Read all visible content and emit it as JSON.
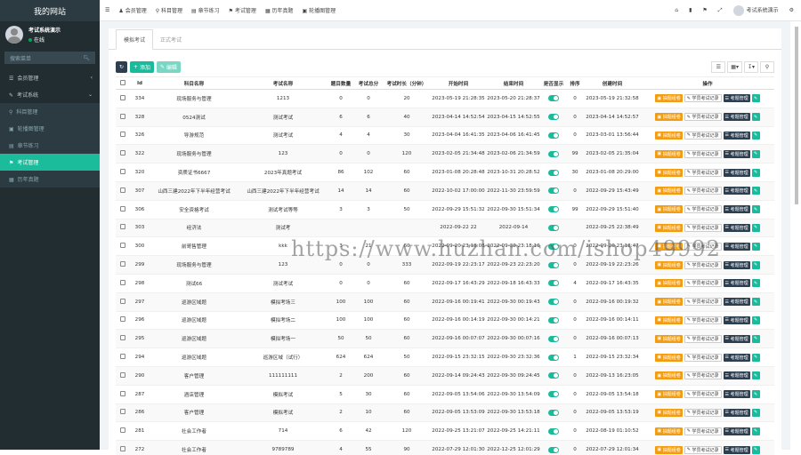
{
  "sidebar": {
    "site_title": "我的网站",
    "user_name": "考试系统演示",
    "user_status": "在线",
    "search_placeholder": "搜索菜单",
    "items": [
      {
        "label": "会员管理",
        "icon": "list-icon"
      },
      {
        "label": "考试系统",
        "icon": "pencil-icon"
      },
      {
        "label": "科目管理",
        "icon": "pin-icon"
      },
      {
        "label": "轮播图管理",
        "icon": "image-icon"
      },
      {
        "label": "章节练习",
        "icon": "book-icon"
      },
      {
        "label": "考试管理",
        "icon": "flag-icon"
      },
      {
        "label": "历年真题",
        "icon": "calendar-icon"
      }
    ]
  },
  "topbar": {
    "nav": [
      "会员管理",
      "科目管理",
      "章节练习",
      "考试管理",
      "历年真题",
      "轮播图管理"
    ],
    "user_name": "考试系统演示"
  },
  "tabs": [
    "模拟考试",
    "正式考试"
  ],
  "toolbar": {
    "add_label": "添加",
    "edit_label": "编辑"
  },
  "table": {
    "headers": [
      "Id",
      "科目名称",
      "考试名称",
      "题目数量",
      "考试总分",
      "考试时长（分钟）",
      "开始时间",
      "结束时间",
      "是否显示",
      "排序",
      "创建时间",
      "操作"
    ],
    "actions": [
      "抽题组卷",
      "学员考试记录",
      "考题管理"
    ],
    "rows": [
      [
        "334",
        "现场服务与管理",
        "1213",
        "0",
        "0",
        "20",
        "2023-05-19 21:28:35",
        "2023-05-20 21:28:37",
        "0",
        "2023-05-19 21:32:58"
      ],
      [
        "328",
        "0524测试",
        "测试考试",
        "6",
        "6",
        "40",
        "2023-04-14 14:52:54",
        "2023-04-15 14:52:55",
        "0",
        "2023-04-14 14:52:57"
      ],
      [
        "326",
        "导游规范",
        "测试考试",
        "4",
        "4",
        "30",
        "2023-04-04 16:41:35",
        "2023-04-06 16:41:45",
        "0",
        "2023-03-01 13:56:44"
      ],
      [
        "322",
        "现场服务与管理",
        "123",
        "0",
        "0",
        "120",
        "2023-02-05 21:34:48",
        "2023-02-06 21:34:59",
        "99",
        "2023-02-05 21:35:04"
      ],
      [
        "320",
        "资质证书6667",
        "2023年真题考试",
        "86",
        "102",
        "60",
        "2023-01-08 20:28:48",
        "2023-10-31 20:28:52",
        "30",
        "2023-01-08 20:29:00"
      ],
      [
        "307",
        "山西三建2022年下半年经营考试",
        "山西三建2022年下半年经营考试",
        "14",
        "14",
        "60",
        "2022-10-02 17:00:00",
        "2022-11-30 23:59:59",
        "0",
        "2022-09-29 15:43:49"
      ],
      [
        "306",
        "安全资格考试",
        "测试考试等等",
        "3",
        "3",
        "50",
        "2022-09-29 15:51:32",
        "2022-09-30 15:51:34",
        "99",
        "2022-09-29 15:51:40"
      ],
      [
        "303",
        "经济法",
        "测试考",
        "",
        "",
        "",
        "2022-09-22 22",
        "2022-09-14",
        "",
        "2022-09-25 22:38:49"
      ],
      [
        "300",
        "前哥售管理",
        "kkk",
        "3",
        "21",
        "60",
        "2022-09-20 23:18:08",
        "2022-09-30 23:18:10",
        "0",
        "2022-09-20 23:18:47"
      ],
      [
        "299",
        "现场服务与管理",
        "123",
        "0",
        "0",
        "333",
        "2022-09-19 22:23:17",
        "2022-09-23 22:23:20",
        "0",
        "2022-09-19 22:23:26"
      ],
      [
        "298",
        "测试66",
        "测试考试",
        "0",
        "0",
        "60",
        "2022-09-17 16:43:29",
        "2022-09-18 16:43:33",
        "4",
        "2022-09-17 16:43:35"
      ],
      [
        "297",
        "巡游区域题",
        "模拟考场三",
        "100",
        "100",
        "60",
        "2022-09-16 00:19:41",
        "2022-09-30 00:19:43",
        "0",
        "2022-09-16 00:19:32"
      ],
      [
        "296",
        "巡游区域题",
        "模拟考场二",
        "100",
        "100",
        "60",
        "2022-09-16 00:14:19",
        "2022-09-30 00:14:21",
        "0",
        "2022-09-16 00:14:11"
      ],
      [
        "295",
        "巡游区域题",
        "模拟考场一",
        "50",
        "50",
        "60",
        "2022-09-16 00:07:07",
        "2022-09-30 00:07:16",
        "0",
        "2022-09-16 00:07:13"
      ],
      [
        "294",
        "巡游区域题",
        "巡游区域（试行）",
        "624",
        "624",
        "50",
        "2022-09-15 23:32:15",
        "2022-09-30 23:32:36",
        "1",
        "2022-09-15 23:32:34"
      ],
      [
        "290",
        "客户管理",
        "111111111",
        "2",
        "200",
        "60",
        "2022-09-14 09:24:43",
        "2022-09-30 09:24:45",
        "0",
        "2022-09-13 16:23:05"
      ],
      [
        "287",
        "酒店管理",
        "模拟考试",
        "5",
        "30",
        "60",
        "2022-09-05 13:54:06",
        "2022-09-30 13:54:09",
        "0",
        "2022-09-05 13:54:18"
      ],
      [
        "286",
        "客户管理",
        "模拟考试",
        "2",
        "10",
        "60",
        "2022-09-05 13:53:09",
        "2022-09-30 13:53:18",
        "0",
        "2022-09-05 13:53:19"
      ],
      [
        "281",
        "社会工作者",
        "714",
        "6",
        "42",
        "120",
        "2022-09-25 13:21:07",
        "2022-09-25 14:21:11",
        "0",
        "2022-08-19 01:10:52"
      ],
      [
        "272",
        "社会工作者",
        "9789789",
        "4",
        "55",
        "90",
        "2022-07-29 12:01:30",
        "2022-12-25 12:01:29",
        "0",
        "2022-07-29 12:01:34"
      ]
    ]
  },
  "watermark": "https://www.huzhan.com/ishop49992"
}
